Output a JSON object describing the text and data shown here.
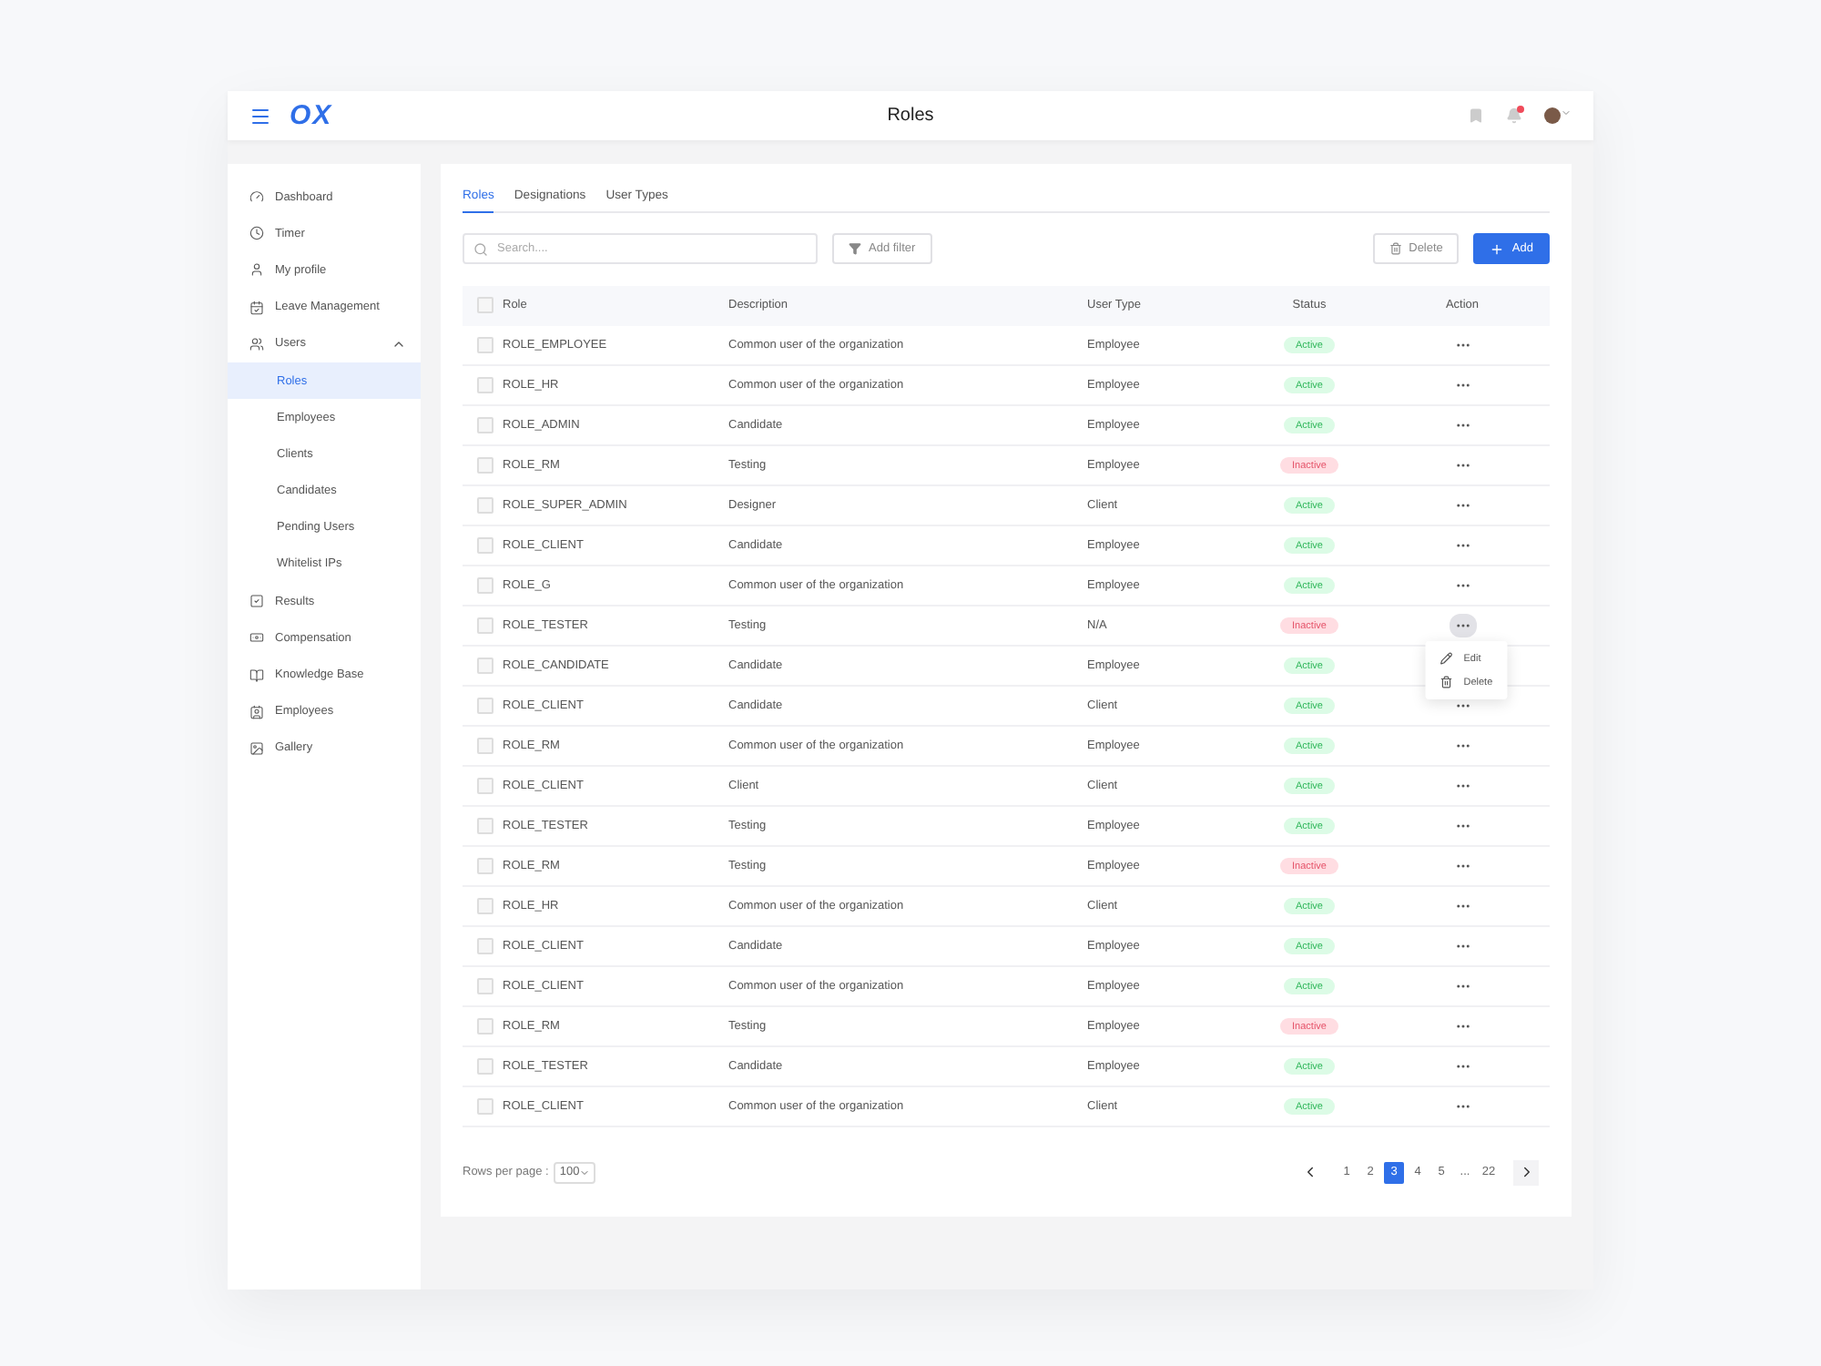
{
  "header": {
    "logo": "OX",
    "title": "Roles",
    "notifications": true
  },
  "sidebar": {
    "items": [
      {
        "label": "Dashboard",
        "selected": false
      },
      {
        "label": "Timer",
        "selected": false
      },
      {
        "label": "My profile",
        "selected": false
      },
      {
        "label": "Leave Management",
        "selected": false
      },
      {
        "label": "Users",
        "selected": false,
        "expanded": true,
        "children": [
          {
            "label": "Roles",
            "selected": true
          },
          {
            "label": "Employees",
            "selected": false
          },
          {
            "label": "Clients",
            "selected": false
          },
          {
            "label": "Candidates",
            "selected": false
          },
          {
            "label": "Pending Users",
            "selected": false
          },
          {
            "label": "Whitelist IPs",
            "selected": false
          }
        ]
      },
      {
        "label": "Results",
        "selected": false
      },
      {
        "label": "Compensation",
        "selected": false
      },
      {
        "label": "Knowledge Base",
        "selected": false
      },
      {
        "label": "Employees",
        "selected": false
      },
      {
        "label": "Gallery",
        "selected": false
      }
    ]
  },
  "tabs": [
    {
      "label": "Roles",
      "selected": true
    },
    {
      "label": "Designations",
      "selected": false
    },
    {
      "label": "User Types",
      "selected": false
    }
  ],
  "search": {
    "placeholder": "Search...."
  },
  "buttons": {
    "filter": "Add filter",
    "delete": "Delete",
    "add": "Add"
  },
  "table": {
    "columns": [
      "Role",
      "Description",
      "User Type",
      "Status",
      "Action"
    ],
    "header_checked": false,
    "rows": [
      {
        "role": "ROLE_EMPLOYEE",
        "description": "Common user of the organization",
        "user_type": "Employee",
        "status": "Active",
        "active": true,
        "checked": false,
        "menu_open": false
      },
      {
        "role": "ROLE_HR",
        "description": "Common user of the organization",
        "user_type": "Employee",
        "status": "Active",
        "active": true,
        "checked": false,
        "menu_open": false
      },
      {
        "role": "ROLE_ADMIN",
        "description": "Candidate",
        "user_type": "Employee",
        "status": "Active",
        "active": true,
        "checked": false,
        "menu_open": false
      },
      {
        "role": "ROLE_RM",
        "description": "Testing",
        "user_type": "Employee",
        "status": "Inactive",
        "active": false,
        "checked": false,
        "menu_open": false
      },
      {
        "role": "ROLE_SUPER_ADMIN",
        "description": "Designer",
        "user_type": "Client",
        "status": "Active",
        "active": true,
        "checked": false,
        "menu_open": false
      },
      {
        "role": "ROLE_CLIENT",
        "description": "Candidate",
        "user_type": "Employee",
        "status": "Active",
        "active": true,
        "checked": false,
        "menu_open": false
      },
      {
        "role": "ROLE_G",
        "description": "Common user of the organization",
        "user_type": "Employee",
        "status": "Active",
        "active": true,
        "checked": false,
        "menu_open": false
      },
      {
        "role": "ROLE_TESTER",
        "description": "Testing",
        "user_type": "N/A",
        "status": "Inactive",
        "active": false,
        "checked": false,
        "menu_open": true
      },
      {
        "role": "ROLE_CANDIDATE",
        "description": "Candidate",
        "user_type": "Employee",
        "status": "Active",
        "active": true,
        "checked": false,
        "menu_open": false
      },
      {
        "role": "ROLE_CLIENT",
        "description": "Candidate",
        "user_type": "Client",
        "status": "Active",
        "active": true,
        "checked": false,
        "menu_open": false
      },
      {
        "role": "ROLE_RM",
        "description": "Common user of the organization",
        "user_type": "Employee",
        "status": "Active",
        "active": true,
        "checked": false,
        "menu_open": false
      },
      {
        "role": "ROLE_CLIENT",
        "description": "Client",
        "user_type": "Client",
        "status": "Active",
        "active": true,
        "checked": false,
        "menu_open": false
      },
      {
        "role": "ROLE_TESTER",
        "description": "Testing",
        "user_type": "Employee",
        "status": "Active",
        "active": true,
        "checked": false,
        "menu_open": false
      },
      {
        "role": "ROLE_RM",
        "description": "Testing",
        "user_type": "Employee",
        "status": "Inactive",
        "active": false,
        "checked": false,
        "menu_open": false
      },
      {
        "role": "ROLE_HR",
        "description": "Common user of the organization",
        "user_type": "Client",
        "status": "Active",
        "active": true,
        "checked": false,
        "menu_open": false
      },
      {
        "role": "ROLE_CLIENT",
        "description": "Candidate",
        "user_type": "Employee",
        "status": "Active",
        "active": true,
        "checked": false,
        "menu_open": false
      },
      {
        "role": "ROLE_CLIENT",
        "description": "Common user of the organization",
        "user_type": "Employee",
        "status": "Active",
        "active": true,
        "checked": false,
        "menu_open": false
      },
      {
        "role": "ROLE_RM",
        "description": "Testing",
        "user_type": "Employee",
        "status": "Inactive",
        "active": false,
        "checked": false,
        "menu_open": false
      },
      {
        "role": "ROLE_TESTER",
        "description": "Candidate",
        "user_type": "Employee",
        "status": "Active",
        "active": true,
        "checked": false,
        "menu_open": false
      },
      {
        "role": "ROLE_CLIENT",
        "description": "Common user of the organization",
        "user_type": "Client",
        "status": "Active",
        "active": true,
        "checked": false,
        "menu_open": false
      }
    ]
  },
  "row_menu": [
    "Edit",
    "Delete"
  ],
  "pagination": {
    "rows_label": "Rows per page :",
    "rows_value": "100",
    "pages": [
      {
        "label": "1",
        "selected": false
      },
      {
        "label": "2",
        "selected": false
      },
      {
        "label": "3",
        "selected": true
      },
      {
        "label": "4",
        "selected": false
      },
      {
        "label": "5",
        "selected": false
      },
      {
        "label": "...",
        "selected": false
      },
      {
        "label": "22",
        "selected": false
      }
    ]
  }
}
